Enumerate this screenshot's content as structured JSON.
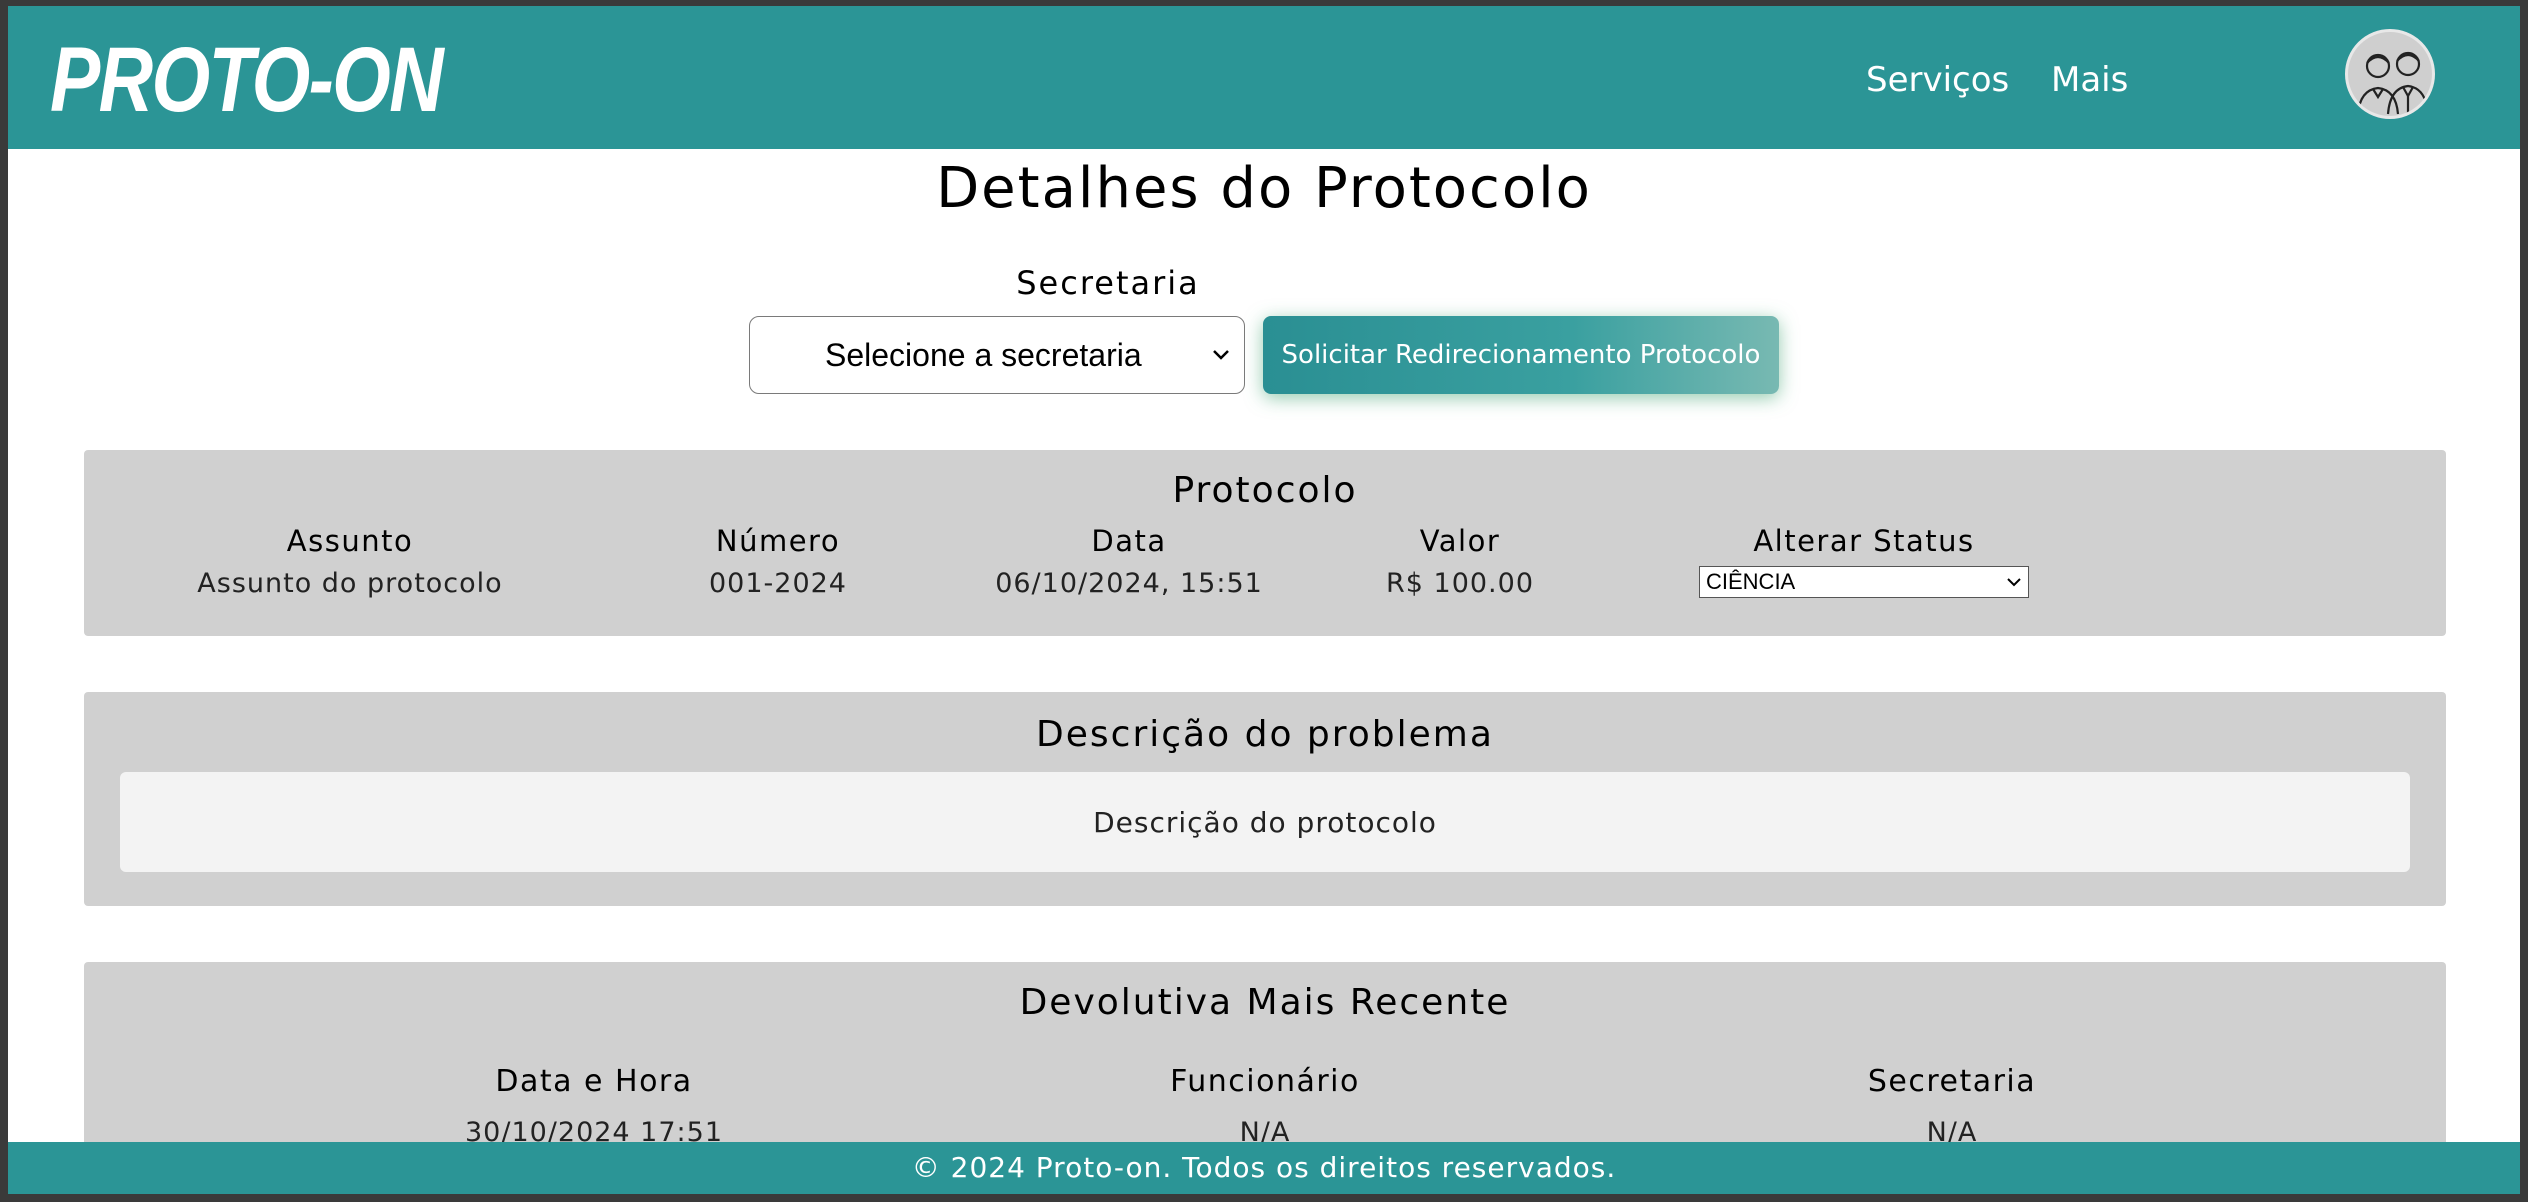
{
  "header": {
    "logo_text": "PROTO-ON",
    "nav": [
      "Serviços",
      "Mais"
    ],
    "avatar_icon": "users-avatar-icon",
    "brand_color": "#2b9596"
  },
  "page": {
    "title": "Detalhes do Protocolo"
  },
  "secretaria": {
    "label": "Secretaria",
    "select_value": "Selecione a secretaria",
    "redirect_button": "Solicitar Redirecionamento Protocolo"
  },
  "protocolo": {
    "title": "Protocolo",
    "fields": [
      {
        "header": "Assunto",
        "value": "Assunto do protocolo"
      },
      {
        "header": "Número",
        "value": "001-2024"
      },
      {
        "header": "Data",
        "value": "06/10/2024, 15:51"
      },
      {
        "header": "Valor",
        "value": "R$ 100.00"
      }
    ],
    "status": {
      "header": "Alterar Status",
      "value": "CIÊNCIA"
    }
  },
  "descricao": {
    "title": "Descrição do problema",
    "text": "Descrição do protocolo"
  },
  "devolutiva": {
    "title": "Devolutiva Mais Recente",
    "columns": [
      "Data e Hora",
      "Funcionário",
      "Secretaria"
    ],
    "row": [
      "30/10/2024 17:51",
      "N/A",
      "N/A"
    ]
  },
  "footer": {
    "text": "© 2024 Proto-on. Todos os direitos reservados."
  }
}
